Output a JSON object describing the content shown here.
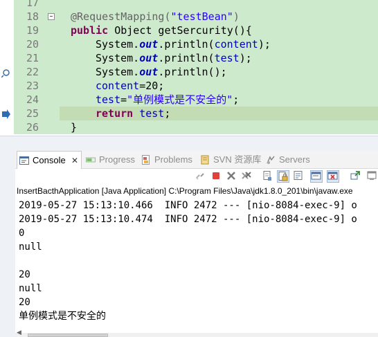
{
  "editor": {
    "lines": [
      {
        "num": "17",
        "marker": "none"
      },
      {
        "num": "18",
        "marker": "fold"
      },
      {
        "num": "19",
        "marker": "none"
      },
      {
        "num": "20",
        "marker": "none"
      },
      {
        "num": "21",
        "marker": "none"
      },
      {
        "num": "22",
        "marker": "change"
      },
      {
        "num": "23",
        "marker": "none"
      },
      {
        "num": "24",
        "marker": "none"
      },
      {
        "num": "25",
        "marker": "current"
      },
      {
        "num": "26",
        "marker": "none"
      }
    ],
    "code": {
      "l18_annotation": "@RequestMapping(",
      "l18_string": "\"testBean\"",
      "l18_close": ")",
      "l19_kw": "public",
      "l19_rest": " Object getSercurity(){",
      "l20_sys": "System.",
      "l20_out": "out",
      "l20_call": ".println(",
      "l20_var": "content",
      "l20_end": ");",
      "l21_sys": "System.",
      "l21_out": "out",
      "l21_call": ".println(",
      "l21_var": "test",
      "l21_end": ");",
      "l22_sys": "System.",
      "l22_out": "out",
      "l22_call": ".println();",
      "l23_var": "content",
      "l23_rest": "=20;",
      "l24_var": "test",
      "l24_eq": "=",
      "l24_string": "\"单例模式是不安全的\"",
      "l24_end": ";",
      "l25_kw": "return",
      "l25_sp": " ",
      "l25_var": "test",
      "l25_end": ";",
      "l26_brace": "}"
    },
    "colors": {
      "line_bg": "#cdeacd",
      "current_line_bg": "#c0d8b0",
      "keyword": "#7f0055",
      "field": "#0000c0",
      "string": "#2a00ff",
      "annotation": "#646464"
    }
  },
  "tabs": {
    "console": {
      "label": "Console",
      "close": "✕",
      "icon": "console-icon"
    },
    "progress": {
      "label": "Progress",
      "icon": "progress-icon"
    },
    "problems": {
      "label": "Problems",
      "icon": "problems-icon"
    },
    "svn": {
      "label": "SVN 资源库",
      "icon": "svn-repository-icon"
    },
    "servers": {
      "label": "Servers",
      "icon": "servers-icon"
    }
  },
  "console": {
    "header": "InsertBacthApplication [Java Application] C:\\Program Files\\Java\\jdk1.8.0_201\\bin\\javaw.exe",
    "output": [
      "2019-05-27 15:13:10.466  INFO 2472 --- [nio-8084-exec-9] o",
      "2019-05-27 15:13:10.474  INFO 2472 --- [nio-8084-exec-9] o",
      "0",
      "null",
      "",
      "20",
      "null",
      "20",
      "单例模式是不安全的"
    ]
  }
}
